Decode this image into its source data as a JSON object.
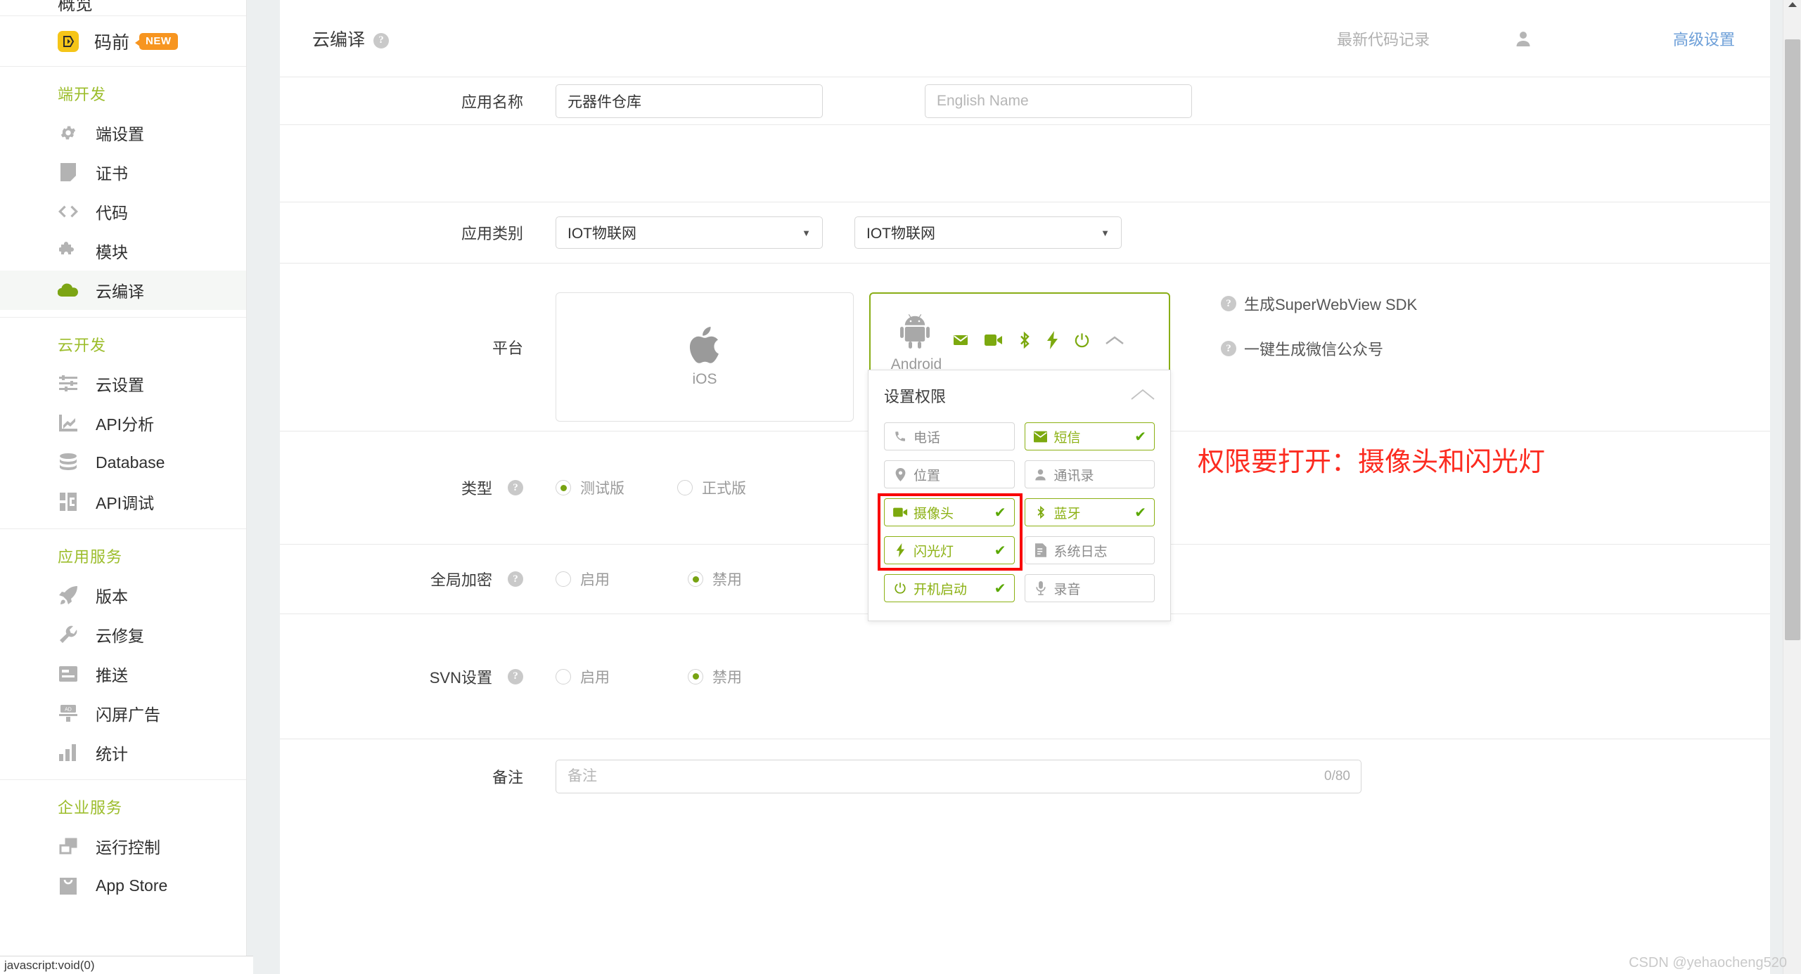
{
  "sidebar": {
    "overview_label": "概览",
    "promo": {
      "label": "码前",
      "badge": "NEW"
    },
    "groups": [
      {
        "title": "端开发",
        "items": [
          {
            "label": "端设置",
            "icon": "gear-icon",
            "active": false
          },
          {
            "label": "证书",
            "icon": "certificate-icon",
            "active": false
          },
          {
            "label": "代码",
            "icon": "code-icon",
            "active": false
          },
          {
            "label": "模块",
            "icon": "puzzle-icon",
            "active": false
          },
          {
            "label": "云编译",
            "icon": "cloud-icon",
            "active": true
          }
        ]
      },
      {
        "title": "云开发",
        "items": [
          {
            "label": "云设置",
            "icon": "sliders-icon",
            "active": false
          },
          {
            "label": "API分析",
            "icon": "chart-line-icon",
            "active": false
          },
          {
            "label": "Database",
            "icon": "database-icon",
            "active": false
          },
          {
            "label": "API调试",
            "icon": "api-debug-icon",
            "active": false
          }
        ]
      },
      {
        "title": "应用服务",
        "items": [
          {
            "label": "版本",
            "icon": "rocket-icon",
            "active": false
          },
          {
            "label": "云修复",
            "icon": "wrench-icon",
            "active": false
          },
          {
            "label": "推送",
            "icon": "push-icon",
            "active": false
          },
          {
            "label": "闪屏广告",
            "icon": "ad-banner-icon",
            "active": false
          },
          {
            "label": "统计",
            "icon": "bar-chart-icon",
            "active": false
          }
        ]
      },
      {
        "title": "企业服务",
        "items": [
          {
            "label": "运行控制",
            "icon": "windows-control-icon",
            "active": false
          },
          {
            "label": "App Store",
            "icon": "app-store-bag-icon",
            "active": false
          }
        ]
      }
    ]
  },
  "header": {
    "title": "云编译",
    "help_icon": "?",
    "latest_code_record": "最新代码记录",
    "user_icon": "user-icon",
    "advanced_settings": "高级设置"
  },
  "form": {
    "app_name": {
      "label": "应用名称",
      "value": "元器件仓库",
      "english_placeholder": "English Name",
      "english_value": ""
    },
    "app_category": {
      "label": "应用类别",
      "primary_value": "IOT物联网",
      "secondary_value": "IOT物联网"
    },
    "platform": {
      "label": "平台",
      "ios": {
        "name": "iOS",
        "selected": false
      },
      "android": {
        "name": "Android",
        "selected": true
      },
      "android_icon_row": [
        {
          "name": "sms-icon",
          "on": true
        },
        {
          "name": "camera-icon",
          "on": true
        },
        {
          "name": "bluetooth-icon",
          "on": true
        },
        {
          "name": "flash-icon",
          "on": true
        },
        {
          "name": "power-icon",
          "on": true
        },
        {
          "name": "chevron-up-icon",
          "on": false
        }
      ]
    },
    "permissions_popup": {
      "title": "设置权限",
      "collapse_icon": "chevron-up-icon",
      "items": [
        {
          "label": "电话",
          "icon": "phone-icon",
          "on": false,
          "highlight": false
        },
        {
          "label": "短信",
          "icon": "envelope-icon",
          "on": true,
          "highlight": false
        },
        {
          "label": "位置",
          "icon": "location-pin-icon",
          "on": false,
          "highlight": false
        },
        {
          "label": "通讯录",
          "icon": "contacts-icon",
          "on": false,
          "highlight": false
        },
        {
          "label": "摄像头",
          "icon": "camera-icon",
          "on": true,
          "highlight": true
        },
        {
          "label": "蓝牙",
          "icon": "bluetooth-icon",
          "on": true,
          "highlight": false
        },
        {
          "label": "闪光灯",
          "icon": "flash-icon",
          "on": true,
          "highlight": true
        },
        {
          "label": "系统日志",
          "icon": "document-icon",
          "on": false,
          "highlight": false
        },
        {
          "label": "开机启动",
          "icon": "power-icon",
          "on": true,
          "highlight": false
        },
        {
          "label": "录音",
          "icon": "microphone-icon",
          "on": false,
          "highlight": false
        }
      ],
      "check_mark": "✔"
    },
    "side_links": [
      {
        "label": "生成SuperWebView SDK"
      },
      {
        "label": "一键生成微信公众号"
      }
    ],
    "annotation": "权限要打开：摄像头和闪光灯",
    "annotation_color": "#fc2b20",
    "type": {
      "label": "类型",
      "options": [
        {
          "label": "测试版",
          "selected": true
        },
        {
          "label": "正式版",
          "selected": false
        }
      ]
    },
    "global_encrypt": {
      "label": "全局加密",
      "options": [
        {
          "label": "启用",
          "selected": false
        },
        {
          "label": "禁用",
          "selected": true
        }
      ]
    },
    "svn_settings": {
      "label": "SVN设置",
      "options": [
        {
          "label": "启用",
          "selected": false
        },
        {
          "label": "禁用",
          "selected": true
        }
      ]
    },
    "note": {
      "label": "备注",
      "placeholder": "备注",
      "value": "",
      "counter": "0/80"
    }
  },
  "statusbar": {
    "text": "javascript:void(0)"
  },
  "watermark": {
    "text": "CSDN @yehaocheng520"
  },
  "colors": {
    "brand_green": "#8cb114",
    "accent_green": "#7ca90f",
    "link_blue": "#6d9fd8",
    "annotation_red": "#fc2b20",
    "badge_orange": "#f79520"
  }
}
